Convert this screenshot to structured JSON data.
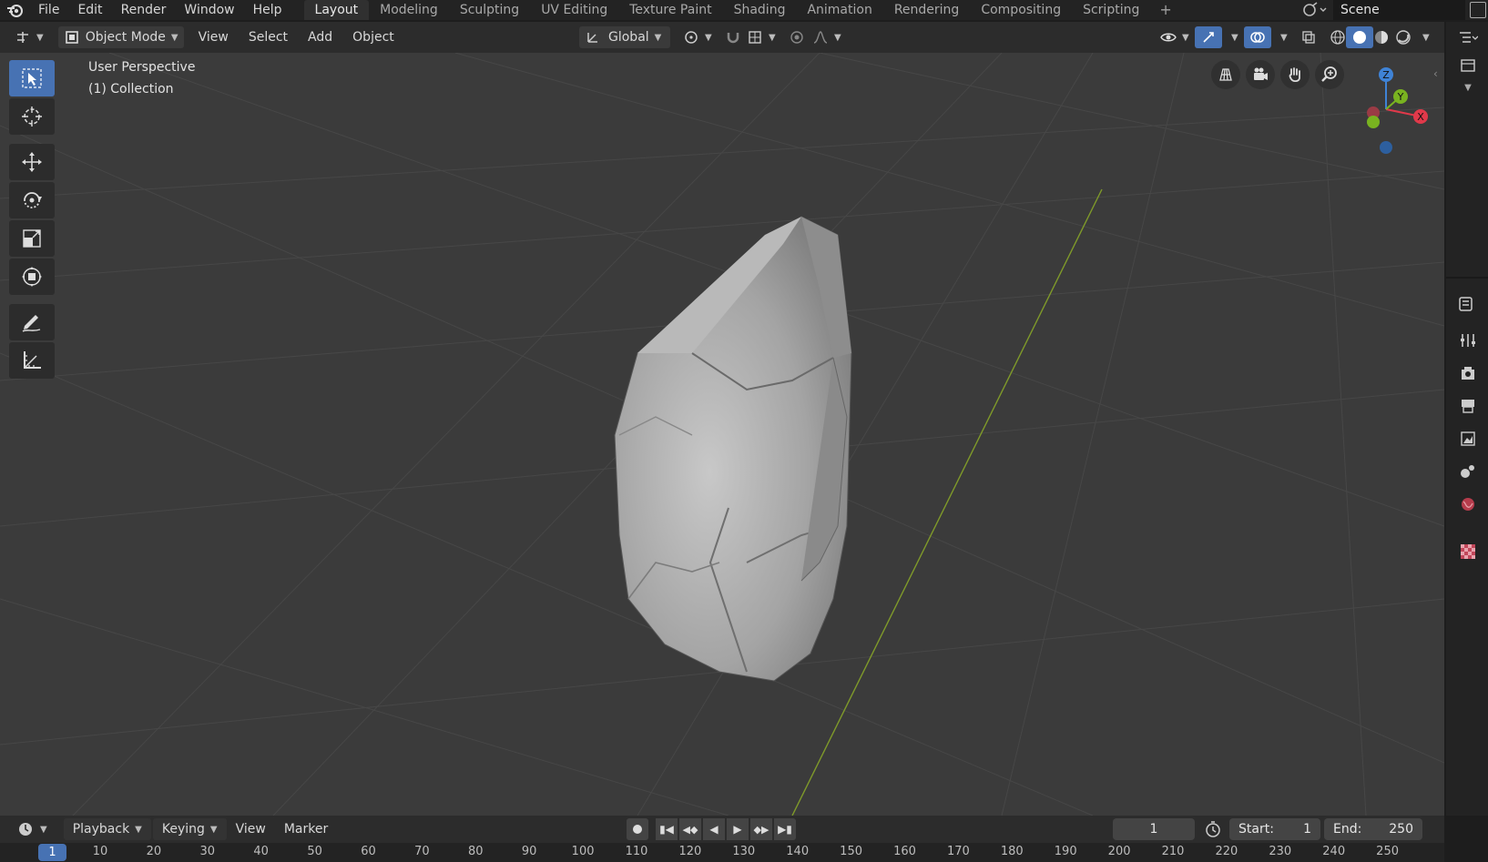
{
  "top_menu": {
    "items": [
      "File",
      "Edit",
      "Render",
      "Window",
      "Help"
    ]
  },
  "workspaces": {
    "tabs": [
      "Layout",
      "Modeling",
      "Sculpting",
      "UV Editing",
      "Texture Paint",
      "Shading",
      "Animation",
      "Rendering",
      "Compositing",
      "Scripting"
    ],
    "active": "Layout",
    "add": "+"
  },
  "scene": {
    "name": "Scene"
  },
  "viewport_header": {
    "mode": "Object Mode",
    "menus": [
      "View",
      "Select",
      "Add",
      "Object"
    ],
    "orientation": "Global"
  },
  "viewport": {
    "perspective_label": "User Perspective",
    "collection_label": "(1) Collection"
  },
  "gizmo": {
    "x": "X",
    "y": "Y",
    "z": "Z"
  },
  "timeline": {
    "menus": [
      "Playback",
      "Keying",
      "View",
      "Marker"
    ],
    "current_frame": "1",
    "start_label": "Start:",
    "start_value": "1",
    "end_label": "End:",
    "end_value": "250",
    "ruler_ticks": [
      "1",
      "10",
      "20",
      "30",
      "40",
      "50",
      "60",
      "70",
      "80",
      "90",
      "100",
      "110",
      "120",
      "130",
      "140",
      "150",
      "160",
      "170",
      "180",
      "190",
      "200",
      "210",
      "220",
      "230",
      "240",
      "250"
    ]
  },
  "colors": {
    "accent": "#4772b3",
    "axis_x": "#e0394a",
    "axis_y": "#79b320",
    "axis_z": "#3f83d6",
    "y_axis_line": "#7f9a2a"
  }
}
